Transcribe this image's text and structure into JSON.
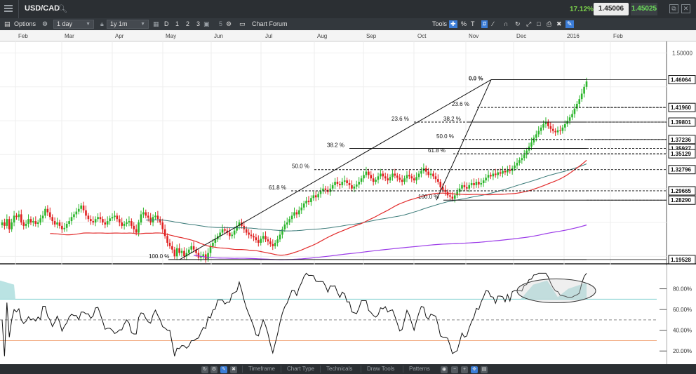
{
  "topbar": {
    "symbol": "USD/CAD",
    "change_pct": "17.12%",
    "bid": "1.45006",
    "ask": "1.45025"
  },
  "toolbar": {
    "options_label": "Options",
    "interval_value": "1 day",
    "range_value": "1y 1m",
    "views": [
      "D",
      "1",
      "2",
      "3"
    ],
    "forum_label": "Chart Forum",
    "tools_label": "Tools",
    "percent_label": "%",
    "text_label": "T"
  },
  "chart_data": [
    {
      "type": "candlestick",
      "x_months": [
        "Feb",
        "Mar",
        "Apr",
        "May",
        "Jun",
        "Jul",
        "Aug",
        "Sep",
        "Oct",
        "Nov",
        "Dec",
        "2016",
        "Feb"
      ],
      "y_ticks": [
        "1.50000"
      ],
      "price_tags": [
        {
          "label": "1.46064",
          "value": 1.46064
        },
        {
          "label": "1.41960",
          "value": 1.4196
        },
        {
          "label": "1.39801",
          "value": 1.39801
        },
        {
          "label": "1.37236",
          "value": 1.37236
        },
        {
          "label": "1.35927",
          "value": 1.35927
        },
        {
          "label": "1.35129",
          "value": 1.35129
        },
        {
          "label": "1.32796",
          "value": 1.32796
        },
        {
          "label": "1.29665",
          "value": 1.29665
        },
        {
          "label": "1.28290",
          "value": 1.2829
        },
        {
          "label": "1.19528",
          "value": 1.19528
        }
      ],
      "fib_major": [
        {
          "label": "0.0 %",
          "value": 1.46064
        },
        {
          "label": "23.6 %",
          "value": 1.39801
        },
        {
          "label": "38.2 %",
          "value": 1.35927
        },
        {
          "label": "50.0 %",
          "value": 1.32796
        },
        {
          "label": "61.8 %",
          "value": 1.29665
        },
        {
          "label": "100.0 %",
          "value": 1.19528
        }
      ],
      "fib_minor": [
        {
          "label": "23.6 %",
          "value": 1.4196
        },
        {
          "label": "38.2 %",
          "value": 1.39801
        },
        {
          "label": "50.0 %",
          "value": 1.37236
        },
        {
          "label": "61.8 %",
          "value": 1.35129
        },
        {
          "label": "100.0 %",
          "value": 1.2829
        }
      ],
      "close_series": [
        1.25,
        1.245,
        1.255,
        1.24,
        1.25,
        1.26,
        1.258,
        1.262,
        1.25,
        1.245,
        1.248,
        1.255,
        1.25,
        1.252,
        1.248,
        1.25,
        1.256,
        1.26,
        1.27,
        1.265,
        1.258,
        1.252,
        1.247,
        1.25,
        1.245,
        1.24,
        1.242,
        1.248,
        1.252,
        1.258,
        1.262,
        1.266,
        1.27,
        1.275,
        1.268,
        1.26,
        1.255,
        1.252,
        1.25,
        1.255,
        1.258,
        1.255,
        1.25,
        1.247,
        1.252,
        1.256,
        1.258,
        1.26,
        1.255,
        1.25,
        1.245,
        1.248,
        1.25,
        1.252,
        1.245,
        1.24,
        1.235,
        1.25,
        1.262,
        1.265,
        1.26,
        1.257,
        1.25,
        1.258,
        1.26,
        1.255,
        1.25,
        1.24,
        1.23,
        1.22,
        1.215,
        1.21,
        1.2,
        1.212,
        1.205,
        1.208,
        1.2,
        1.205,
        1.21,
        1.215,
        1.21,
        1.205,
        1.198,
        1.2,
        1.203,
        1.196,
        1.205,
        1.215,
        1.22,
        1.225,
        1.23,
        1.235,
        1.24,
        1.238,
        1.235,
        1.23,
        1.232,
        1.238,
        1.245,
        1.25,
        1.245,
        1.24,
        1.235,
        1.232,
        1.23,
        1.228,
        1.224,
        1.22,
        1.226,
        1.23,
        1.225,
        1.222,
        1.218,
        1.215,
        1.22,
        1.225,
        1.232,
        1.24,
        1.247,
        1.25,
        1.255,
        1.26,
        1.265,
        1.262,
        1.268,
        1.272,
        1.278,
        1.282,
        1.28,
        1.286,
        1.29,
        1.287,
        1.292,
        1.296,
        1.3,
        1.298,
        1.295,
        1.3,
        1.305,
        1.31,
        1.307,
        1.305,
        1.31,
        1.312,
        1.308,
        1.305,
        1.3,
        1.303,
        1.306,
        1.31,
        1.315,
        1.32,
        1.325,
        1.32,
        1.315,
        1.31,
        1.313,
        1.318,
        1.322,
        1.318,
        1.315,
        1.312,
        1.317,
        1.322,
        1.319,
        1.316,
        1.313,
        1.31,
        1.315,
        1.32,
        1.318,
        1.315,
        1.312,
        1.317,
        1.322,
        1.326,
        1.33,
        1.325,
        1.32,
        1.322,
        1.318,
        1.314,
        1.31,
        1.302,
        1.298,
        1.295,
        1.29,
        1.288,
        1.285,
        1.29,
        1.295,
        1.3,
        1.305,
        1.302,
        1.3,
        1.305,
        1.308,
        1.305,
        1.31,
        1.306,
        1.308,
        1.312,
        1.316,
        1.32,
        1.318,
        1.322,
        1.32,
        1.324,
        1.322,
        1.326,
        1.324,
        1.328,
        1.326,
        1.33,
        1.334,
        1.338,
        1.342,
        1.345,
        1.35,
        1.356,
        1.362,
        1.368,
        1.375,
        1.38,
        1.385,
        1.39,
        1.395,
        1.398,
        1.392,
        1.388,
        1.385,
        1.383,
        1.386,
        1.385,
        1.39,
        1.395,
        1.4,
        1.405,
        1.41,
        1.418,
        1.425,
        1.432,
        1.44,
        1.45,
        1.458
      ]
    },
    {
      "type": "line",
      "name": "oscillator",
      "y_ticks": [
        "80.00%",
        "60.00%",
        "40.00%",
        "20.00%"
      ],
      "ylim": [
        10,
        100
      ],
      "levels": [
        70,
        50,
        30
      ]
    }
  ],
  "bottombar": {
    "tabs": [
      "Timeframe",
      "Chart Type",
      "Technicals",
      "Draw Tools",
      "Patterns"
    ]
  },
  "colors": {
    "bull": "#2cb62c",
    "bear": "#e02020",
    "ma_red": "#e22c2c",
    "ma_purple": "#9b3ae8",
    "ma_teal": "#3a7a78"
  }
}
